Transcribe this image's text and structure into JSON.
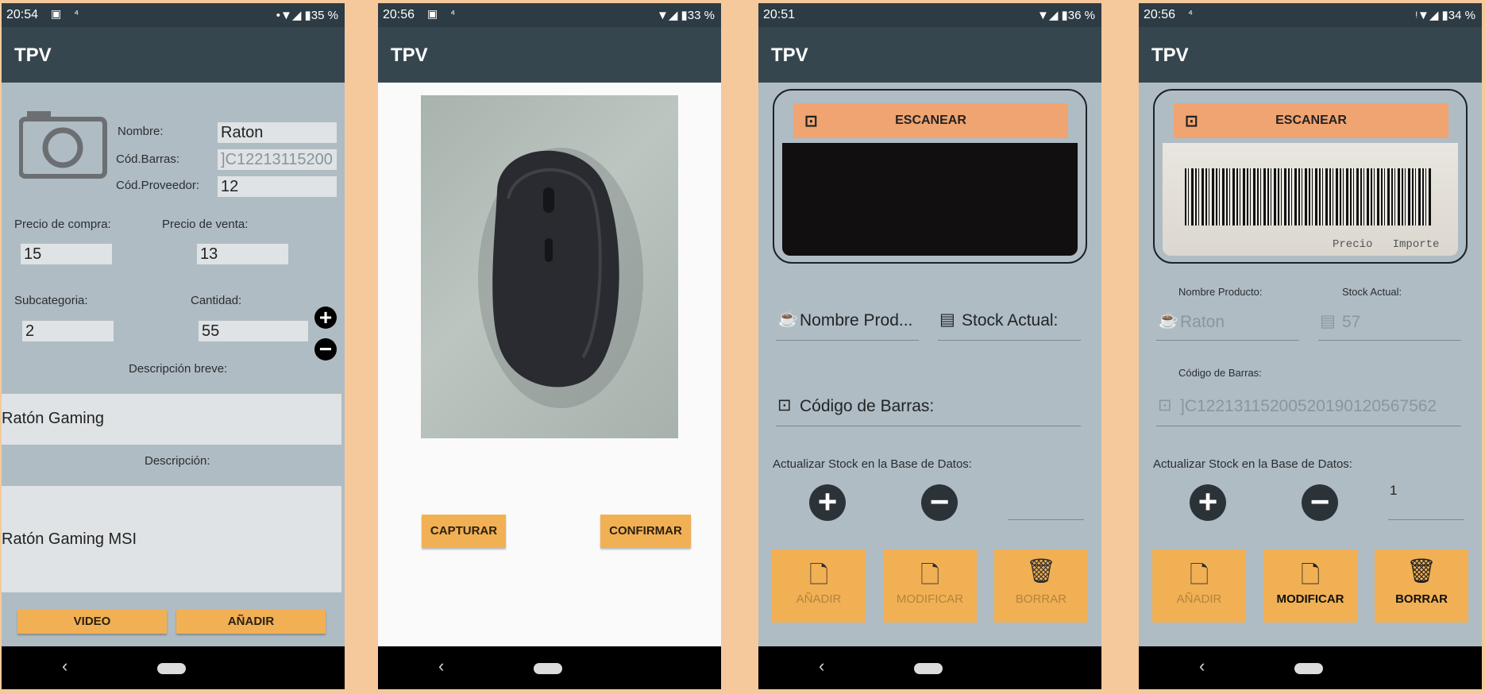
{
  "screens": [
    {
      "status": {
        "time": "20:54",
        "right": "•▼◢ ▮35 %"
      },
      "app_title": "TPV",
      "form": {
        "nombre_label": "Nombre:",
        "nombre_value": "Raton",
        "barras_label": "Cód.Barras:",
        "barras_value": "]C12213115200",
        "proveedor_label": "Cód.Proveedor:",
        "proveedor_value": "12",
        "compra_label": "Precio de compra:",
        "compra_value": "15",
        "venta_label": "Precio de venta:",
        "venta_value": "13",
        "subcat_label": "Subcategoria:",
        "subcat_value": "2",
        "cantidad_label": "Cantidad:",
        "cantidad_value": "55",
        "desc_breve_label": "Descripción breve:",
        "desc_breve_value": "Ratón Gaming",
        "desc_label": "Descripción:",
        "desc_value": "Ratón Gaming MSI"
      },
      "buttons": {
        "video": "VIDEO",
        "add": "AÑADIR"
      }
    },
    {
      "status": {
        "time": "20:56",
        "right": "▼◢ ▮33 %"
      },
      "app_title": "TPV",
      "buttons": {
        "capture": "CAPTURAR",
        "confirm": "CONFIRMAR"
      }
    },
    {
      "status": {
        "time": "20:51",
        "right": "▼◢ ▮36 %"
      },
      "app_title": "TPV",
      "scan_label": "ESCANEAR",
      "nombre_hint": "Nombre Prod...",
      "stock_hint": "Stock Actual:",
      "codigo_hint": "Código de Barras:",
      "update_label": "Actualizar Stock en la Base de Datos:",
      "qty_value": "",
      "actions": {
        "add": "AÑADIR",
        "modify": "MODIFICAR",
        "delete": "BORRAR"
      }
    },
    {
      "status": {
        "time": "20:56",
        "right": "ᵎ▼◢ ▮34 %"
      },
      "app_title": "TPV",
      "scan_label": "ESCANEAR",
      "barcode_text_bottom": "Precio   Importe",
      "nombre_label": "Nombre Producto:",
      "stock_label": "Stock Actual:",
      "nombre_value": "Raton",
      "stock_value": "57",
      "codigo_label": "Código de Barras:",
      "codigo_value": "]C12213115200520190120567562",
      "update_label": "Actualizar Stock en la Base de Datos:",
      "qty_value": "1",
      "actions": {
        "add": "AÑADIR",
        "modify": "MODIFICAR",
        "delete": "BORRAR"
      }
    }
  ],
  "colors": {
    "appbar": "#36464f",
    "background": "#b0bcc3",
    "accent": "#f2b054",
    "scan": "#f0a471"
  }
}
